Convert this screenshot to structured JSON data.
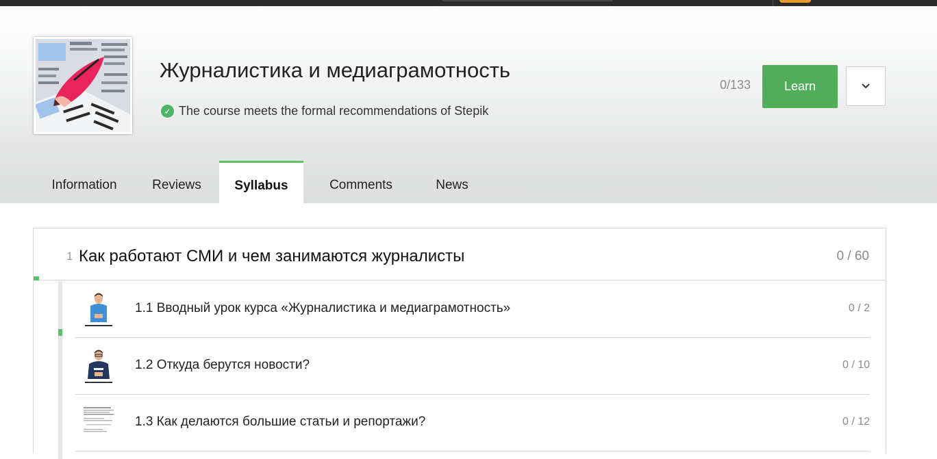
{
  "course": {
    "title": "Журналистика и медиаграмотность",
    "badge": "The course meets the formal recommendations of Stepik",
    "progress": "0/133",
    "learn_label": "Learn"
  },
  "tabs": [
    {
      "label": "Information"
    },
    {
      "label": "Reviews"
    },
    {
      "label": "Syllabus"
    },
    {
      "label": "Comments"
    },
    {
      "label": "News"
    }
  ],
  "active_tab": "Syllabus",
  "colors": {
    "accent_green": "#52ad5b",
    "active_tab_border": "#5cc06b",
    "check_green": "#4db568"
  },
  "section": {
    "number": "1",
    "title": "Как работают СМИ и чем занимаются журналисты",
    "progress": "0 / 60"
  },
  "lessons": [
    {
      "title": "1.1 Вводный урок курса «Журналистика и медиаграмотность»",
      "progress": "0 / 2",
      "thumb": "presenter-blue-shirt"
    },
    {
      "title": "1.2 Откуда берутся новости?",
      "progress": "0 / 10",
      "thumb": "presenter-navy-hoodie"
    },
    {
      "title": "1.3 Как делаются большие статьи и репортажи?",
      "progress": "0 / 12",
      "thumb": "text-document"
    }
  ]
}
